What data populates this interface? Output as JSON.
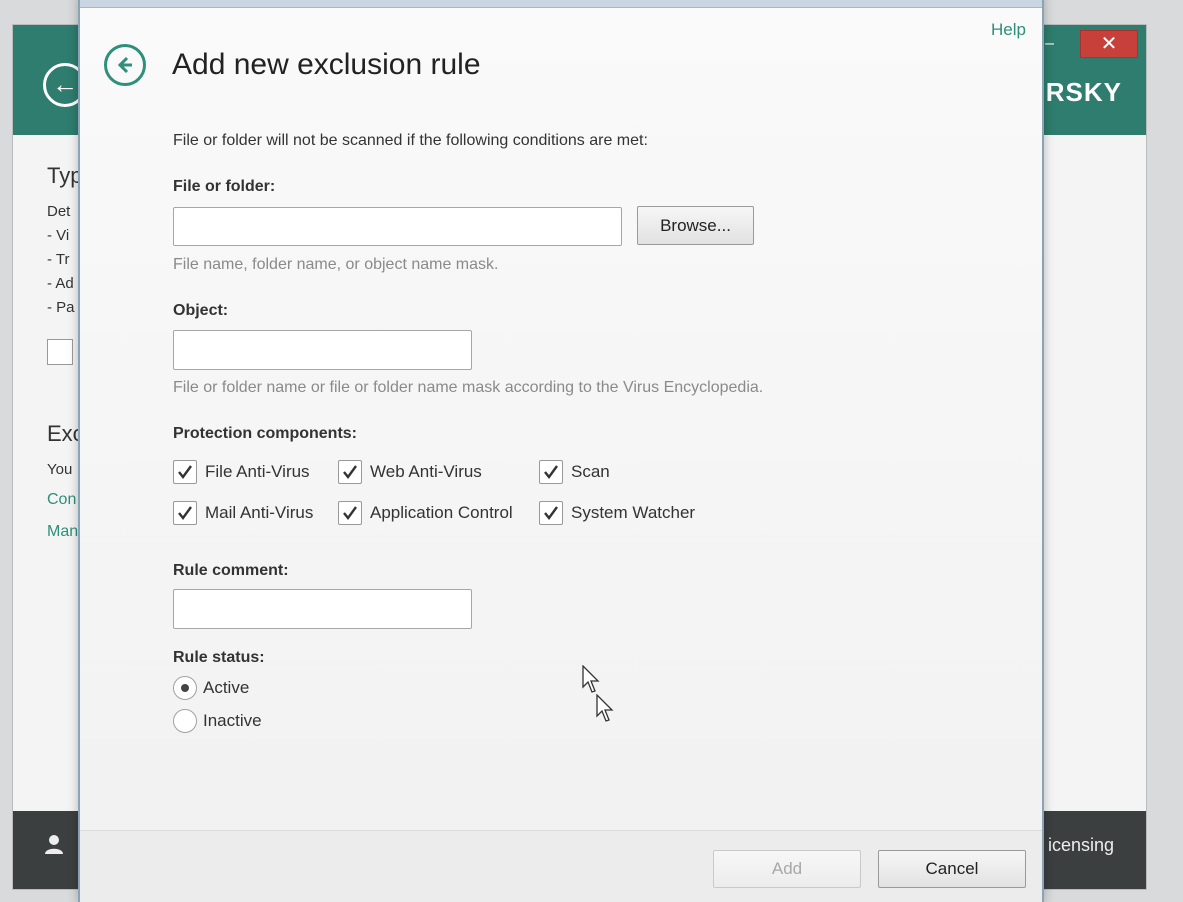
{
  "background_app": {
    "back_icon": "back-arrow-icon",
    "logo_text": "RSKY",
    "close_symbol": "✕",
    "minimize_symbol": "–",
    "section_title": "Typ",
    "lines": [
      "Det",
      "- Vi",
      "- Tr",
      "- Ad",
      "- Pa"
    ],
    "section2_title": "Exc",
    "section2_line": "You",
    "links": [
      "Con",
      "Man"
    ],
    "footer_icon": "user-icon",
    "footer_right": "icensing"
  },
  "dialog": {
    "help_label": "Help",
    "back_icon": "back-arrow-icon",
    "title": "Add new exclusion rule",
    "intro": "File or folder will not be scanned if the following conditions are met:",
    "file_folder": {
      "label": "File or folder:",
      "value": "",
      "browse_label": "Browse...",
      "hint": "File name, folder name, or object name mask."
    },
    "object": {
      "label": "Object:",
      "value": "",
      "hint": "File or folder name or file or folder name mask according to the Virus Encyclopedia."
    },
    "protection": {
      "label": "Protection components:",
      "components": [
        {
          "label": "File Anti-Virus",
          "checked": true
        },
        {
          "label": "Web Anti-Virus",
          "checked": true
        },
        {
          "label": "Scan",
          "checked": true
        },
        {
          "label": "Mail Anti-Virus",
          "checked": true
        },
        {
          "label": "Application Control",
          "checked": true
        },
        {
          "label": "System Watcher",
          "checked": true
        }
      ]
    },
    "rule_comment": {
      "label": "Rule comment:",
      "value": ""
    },
    "rule_status": {
      "label": "Rule status:",
      "options": [
        {
          "label": "Active",
          "selected": true
        },
        {
          "label": "Inactive",
          "selected": false
        }
      ]
    },
    "add_label": "Add",
    "cancel_label": "Cancel"
  }
}
